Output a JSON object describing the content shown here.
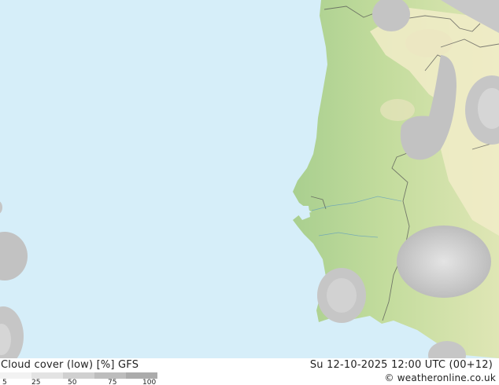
{
  "footer": {
    "title": "Cloud cover (low) [%] GFS",
    "datetime": "Su 12-10-2025 12:00 UTC (00+12)",
    "credit": "© weatheronline.co.uk"
  },
  "legend": {
    "ticks": [
      "5",
      "25",
      "50",
      "75",
      "100"
    ],
    "colors": [
      "#f2f2f2",
      "#e3e3e3",
      "#d0d0d0",
      "#bdbdbd",
      "#ababab"
    ]
  },
  "map": {
    "region": "Portugal and western Spain",
    "sea_color": "#d6eef9",
    "land_colors": [
      "#b8d89a",
      "#d5e2a6",
      "#f1ecc8"
    ],
    "cloud_colors": [
      "#c0c0c0",
      "#cfcfcf",
      "#dedede"
    ]
  }
}
